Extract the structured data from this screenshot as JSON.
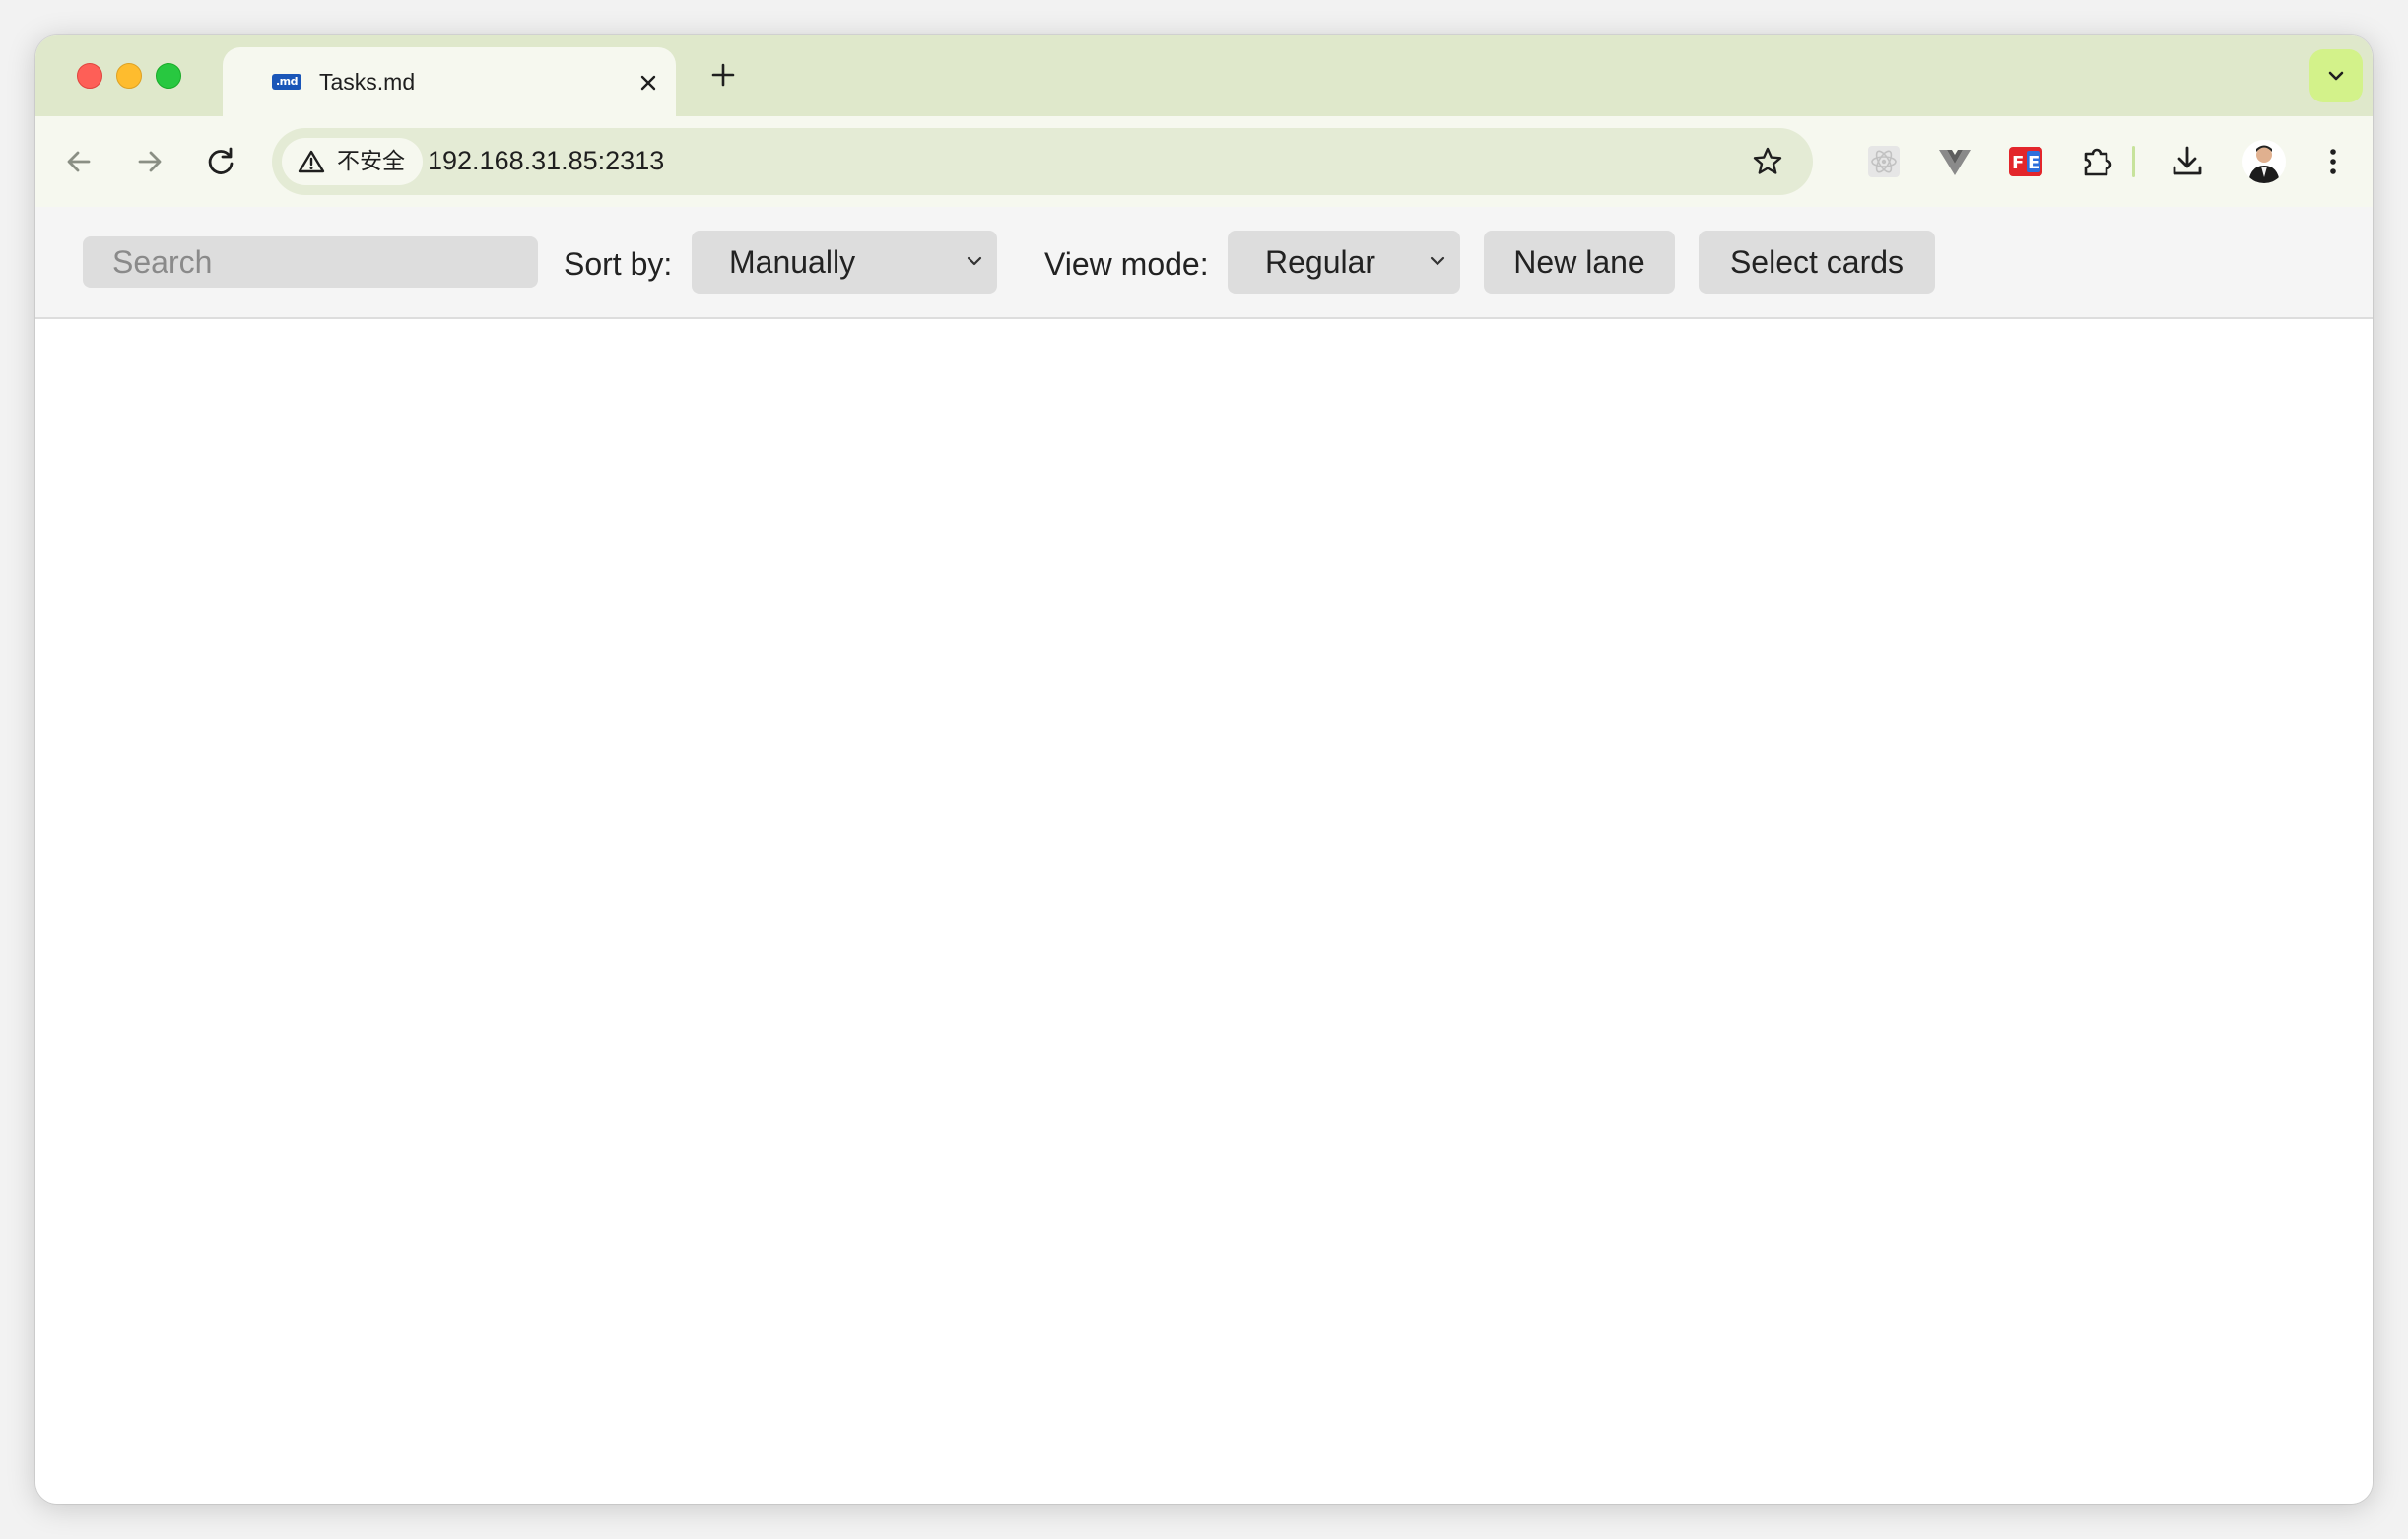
{
  "browser": {
    "tab": {
      "title": "Tasks.md",
      "favicon_text": ".md",
      "favicon_color": "#1a56b8"
    },
    "address": {
      "security_label": "不安全",
      "url": "192.168.31.85:2313"
    },
    "accent_color": "#dfe8cb"
  },
  "board": {
    "search": {
      "placeholder": "Search",
      "value": ""
    },
    "sort": {
      "label": "Sort by:",
      "selected": "Manually"
    },
    "view_mode": {
      "label": "View mode:",
      "selected": "Regular"
    },
    "buttons": {
      "new_lane": "New lane",
      "select_cards": "Select cards"
    }
  },
  "icons": {
    "traffic_lights": [
      "close-dot",
      "minimize-dot",
      "zoom-dot"
    ],
    "toolbar": [
      "back-arrow-icon",
      "forward-arrow-icon",
      "reload-icon",
      "warning-icon",
      "star-icon"
    ],
    "extensions": [
      "react-devtools-icon",
      "vue-devtools-icon",
      "fe-helper-icon",
      "puzzle-icon",
      "download-icon",
      "profile-avatar",
      "kebab-menu-icon"
    ]
  }
}
